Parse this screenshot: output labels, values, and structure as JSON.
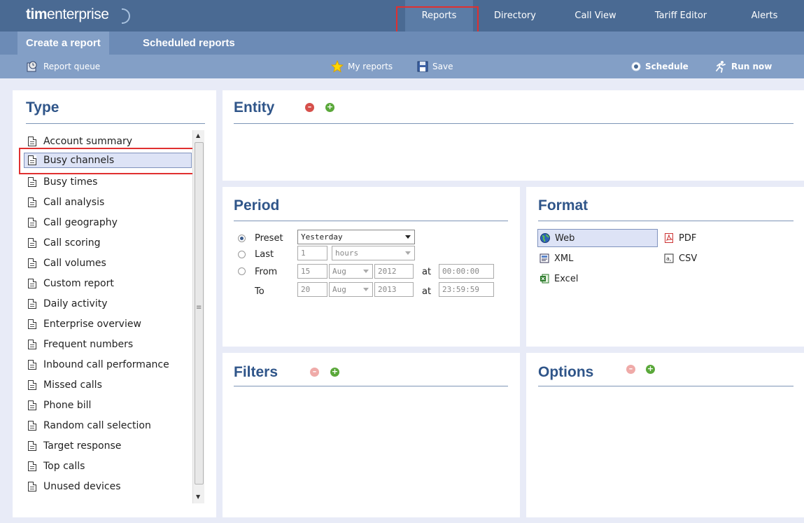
{
  "app": {
    "logo_bold": "tim",
    "logo_light": "enterprise"
  },
  "topnav": {
    "items": [
      {
        "label": "Reports",
        "active": true
      },
      {
        "label": "Directory"
      },
      {
        "label": "Call View"
      },
      {
        "label": "Tariff Editor"
      },
      {
        "label": "Alerts"
      }
    ]
  },
  "subtabs": [
    {
      "label": "Create a report",
      "active": true
    },
    {
      "label": "Scheduled reports"
    }
  ],
  "toolbar": {
    "report_queue": "Report queue",
    "my_reports": "My reports",
    "save": "Save",
    "schedule": "Schedule",
    "run_now": "Run now"
  },
  "type_panel": {
    "title": "Type",
    "items": [
      "Account summary",
      "Busy channels",
      "Busy times",
      "Call analysis",
      "Call geography",
      "Call scoring",
      "Call volumes",
      "Custom report",
      "Daily activity",
      "Enterprise overview",
      "Frequent numbers",
      "Inbound call performance",
      "Missed calls",
      "Phone bill",
      "Random call selection",
      "Target response",
      "Top calls",
      "Unused devices"
    ],
    "selected": "Busy channels"
  },
  "entity_panel": {
    "title": "Entity"
  },
  "period_panel": {
    "title": "Period",
    "preset_label": "Preset",
    "preset_value": "Yesterday",
    "last_label": "Last",
    "last_value": "1",
    "last_unit": "hours",
    "from_label": "From",
    "to_label": "To",
    "at_label": "at",
    "from_day": "15",
    "from_month": "Aug",
    "from_year": "2012",
    "from_time": "00:00:00",
    "to_day": "20",
    "to_month": "Aug",
    "to_year": "2013",
    "to_time": "23:59:59",
    "selected": "Preset"
  },
  "format_panel": {
    "title": "Format",
    "web": "Web",
    "pdf": "PDF",
    "xml": "XML",
    "csv": "CSV",
    "excel": "Excel",
    "selected": "Web"
  },
  "filters_panel": {
    "title": "Filters"
  },
  "options_panel": {
    "title": "Options"
  },
  "colors": {
    "header_bg": "#4a6a93",
    "subbar_bg": "#6c8bb6",
    "toolbar_bg": "#839fc6",
    "title_color": "#2f5589",
    "highlight": "#e03030"
  }
}
